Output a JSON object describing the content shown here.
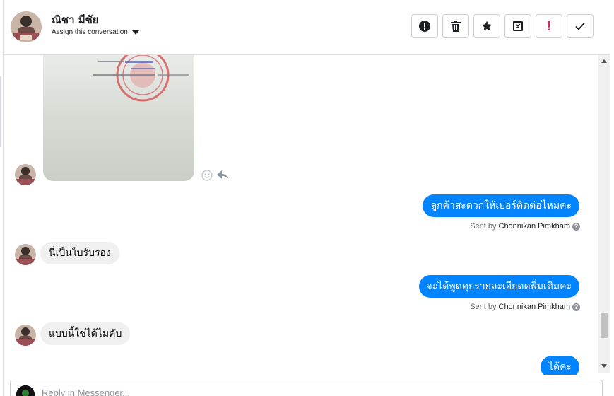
{
  "header": {
    "contact_name": "ณิชา มีชัย",
    "assign_label": "Assign this conversation"
  },
  "toolbar": {
    "buttons": [
      {
        "name": "mark-spam-button",
        "icon": "alert-circle-icon"
      },
      {
        "name": "delete-button",
        "icon": "trash-icon"
      },
      {
        "name": "star-button",
        "icon": "star-icon"
      },
      {
        "name": "archive-button",
        "icon": "inbox-icon"
      },
      {
        "name": "follow-up-button",
        "icon": "exclamation-icon"
      },
      {
        "name": "mark-done-button",
        "icon": "check-icon"
      }
    ]
  },
  "messages": [
    {
      "side": "in",
      "type": "image",
      "alt": "certificate document photo"
    },
    {
      "side": "out",
      "text": "ลูกค้าสะดวกให้เบอร์ติดต่อไหมคะ",
      "sent_by_label": "Sent by",
      "agent": "Chonnikan Pimkham"
    },
    {
      "side": "in",
      "text": "นี่เป็นใบรับรอง"
    },
    {
      "side": "out",
      "text": "จะได้พูดคุยรายละเอียดดพิ่มเติมคะ",
      "sent_by_label": "Sent by",
      "agent": "Chonnikan Pimkham"
    },
    {
      "side": "in",
      "text": "แบบนี้ใช่ได้ไมคับ"
    },
    {
      "side": "out",
      "text": "ได้คะ"
    }
  ],
  "composer": {
    "placeholder": "Reply in Messenger..."
  },
  "colors": {
    "outgoing_bubble": "#0084ff",
    "incoming_bubble": "#f0f0f0",
    "follow_up_accent": "#e0245e"
  }
}
